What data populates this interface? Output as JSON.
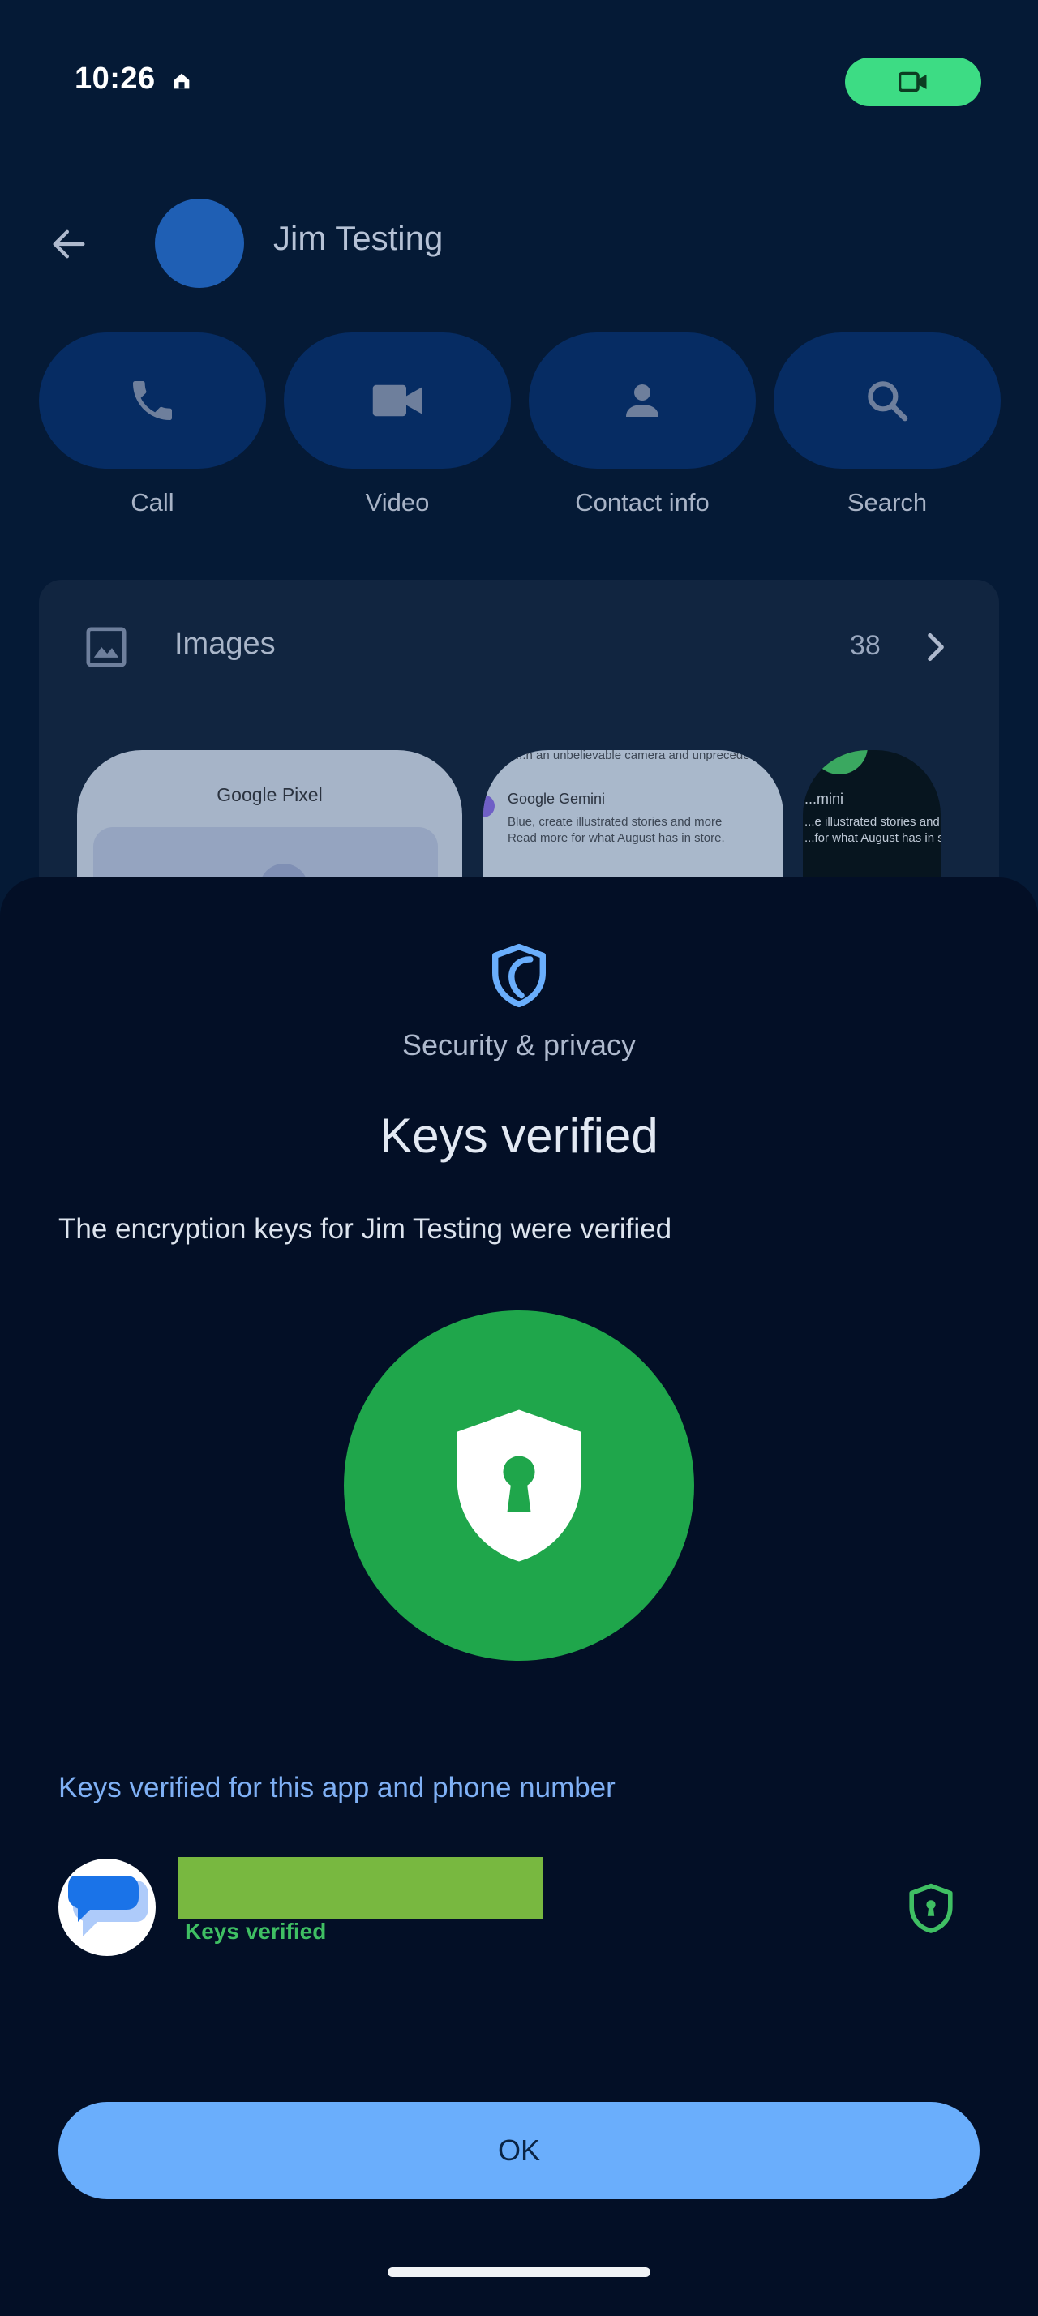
{
  "status_bar": {
    "time": "10:26",
    "notification_icon": "home-notification-icon",
    "call_pill_icon": "videocam-icon",
    "call_pill_color": "#3ddc84"
  },
  "header": {
    "back_icon": "arrow-back-icon",
    "contact_name": "Jim Testing"
  },
  "actions": [
    {
      "label": "Call",
      "icon": "phone-icon"
    },
    {
      "label": "Video",
      "icon": "videocam-icon"
    },
    {
      "label": "Contact info",
      "icon": "person-icon"
    },
    {
      "label": "Search",
      "icon": "search-icon"
    }
  ],
  "images": {
    "title": "Images",
    "count": "38",
    "thumbs": [
      {
        "title": "Google Pixel"
      },
      {
        "top_line": "...n an unbelievable camera and unprecedente...",
        "heading": "Google Gemini",
        "line1": "Blue, create illustrated stories and more",
        "line2": "Read more for what August has in store."
      },
      {
        "heading": "...mini",
        "line1": "...e illustrated stories and more",
        "line2": "...for what August has in store"
      }
    ]
  },
  "sheet": {
    "section_label": "Security & privacy",
    "title": "Keys verified",
    "description": "The encryption keys for Jim Testing were verified",
    "verified_for": "Keys verified for this app and phone number",
    "row_status": "Keys verified",
    "ok_label": "OK"
  },
  "colors": {
    "background": "#051a36",
    "sheet": "#030f26",
    "accent_blue": "#6aaefc",
    "verified_green": "#1fa64b",
    "verified_text_green": "#3fbf63"
  }
}
